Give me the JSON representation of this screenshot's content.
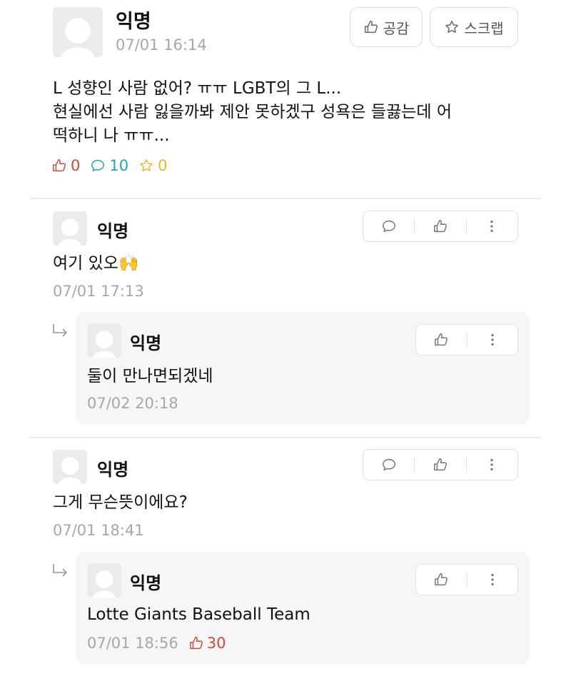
{
  "post": {
    "author": "익명",
    "time": "07/01 16:14",
    "like_button_label": "공감",
    "scrap_button_label": "스크랩",
    "body_line1": "L 성향인 사람 없어? ㅠㅠ LGBT의 그 L...",
    "body_line2": "현실에선 사람 잃을까봐 제안 못하겠구 성욕은 들끓는데 어",
    "body_line3": "떡하니 나 ㅠㅠ...",
    "likes": "0",
    "comments": "10",
    "scraps": "0"
  },
  "comments": [
    {
      "author": "익명",
      "text": "여기 있오🙌",
      "time": "07/01 17:13",
      "reply": {
        "author": "익명",
        "text": "둘이 만나면되겠네",
        "time": "07/02 20:18"
      }
    },
    {
      "author": "익명",
      "text": "그게 무슨뜻이에요?",
      "time": "07/01 18:41",
      "reply": {
        "author": "익명",
        "text": "Lotte Giants Baseball Team",
        "time": "07/01 18:56",
        "likes": "30"
      }
    }
  ],
  "colors": {
    "like_red": "#d3493a",
    "comment_teal": "#27a1b8",
    "scrap_yellow": "#e9b82b",
    "meta_gray": "#a7a7a7"
  }
}
